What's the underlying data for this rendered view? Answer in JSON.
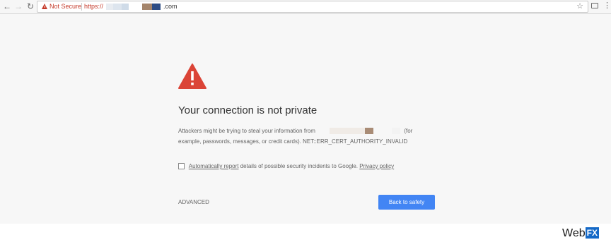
{
  "browser": {
    "security_label": "Not Secure",
    "url_scheme": "https://",
    "url_suffix": ".com",
    "icons": [
      "back-arrow",
      "forward-arrow",
      "reload",
      "warning-triangle",
      "bookmark-star",
      "cast",
      "kebab-menu"
    ]
  },
  "interstitial": {
    "icon": "warning-triangle",
    "heading": "Your connection is not private",
    "para_part1": "Attackers might be trying to steal your information from",
    "para_part2": "(for example, passwords, messages, or credit cards).",
    "error_code": "NET::ERR_CERT_AUTHORITY_INVALID",
    "checkbox_link": "Automatically report",
    "checkbox_text": "details of possible security incidents to Google.",
    "privacy_link": "Privacy policy",
    "advanced_label": "ADVANCED",
    "back_button_label": "Back to safety"
  },
  "watermark": {
    "brand_part1": "Web",
    "brand_part2": "FX"
  },
  "colors": {
    "warning_red": "#c53929",
    "primary_blue": "#4285f4",
    "page_bg": "#f7f7f7"
  }
}
